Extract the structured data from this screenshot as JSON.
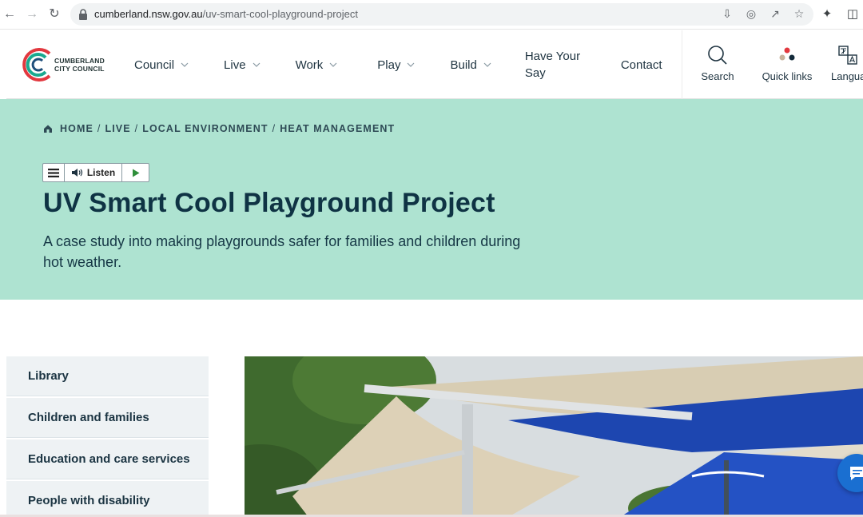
{
  "browser": {
    "url_domain": "cumberland.nsw.gov.au",
    "url_path": "/uv-smart-cool-playground-project",
    "icons": [
      "back-icon",
      "forward-icon",
      "reload-icon",
      "lock-icon",
      "install-icon",
      "eye-off-icon",
      "share-icon",
      "star-icon",
      "extensions-icon",
      "sidepanel-icon"
    ]
  },
  "site": {
    "logo_line1": "CUMBERLAND",
    "logo_line2": "CITY COUNCIL",
    "nav": [
      {
        "label": "Council"
      },
      {
        "label": "Live"
      },
      {
        "label": "Work"
      },
      {
        "label": "Play"
      },
      {
        "label": "Build"
      },
      {
        "label": "Have Your Say"
      },
      {
        "label": "Contact"
      }
    ],
    "tools": {
      "search": "Search",
      "quick_links": "Quick links",
      "language": "Langua"
    }
  },
  "hero": {
    "breadcrumb": [
      "HOME",
      "LIVE",
      "LOCAL ENVIRONMENT",
      "HEAT MANAGEMENT"
    ],
    "listen_label": "Listen",
    "title": "UV Smart Cool Playground Project",
    "subtitle": "A case study into making playgrounds safer for families and children during hot weather."
  },
  "sidebar": {
    "items": [
      {
        "label": "Library"
      },
      {
        "label": "Children and families"
      },
      {
        "label": "Education and care services"
      },
      {
        "label": "People with disability"
      }
    ]
  },
  "colors": {
    "hero_bg": "#aee3d1",
    "title": "#0f3344",
    "sidebar_bg": "#eef2f4",
    "chat_button": "#1a6fd1"
  }
}
